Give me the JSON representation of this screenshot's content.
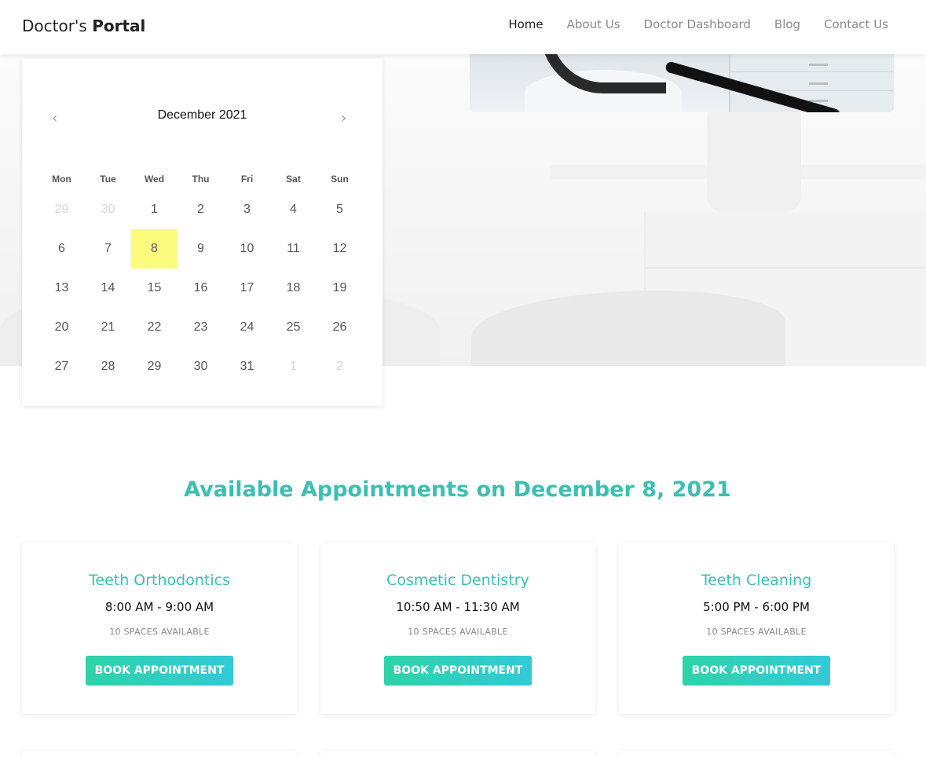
{
  "header": {
    "logo_regular": "Doctor's",
    "logo_bold": "Portal",
    "nav": [
      {
        "label": "Home",
        "active": true
      },
      {
        "label": "About Us"
      },
      {
        "label": "Doctor Dashboard"
      },
      {
        "label": "Blog"
      },
      {
        "label": "Contact Us"
      }
    ]
  },
  "calendar": {
    "month_label": "December 2021",
    "prev_icon": "‹",
    "next_icon": "›",
    "weekdays": [
      "Mon",
      "Tue",
      "Wed",
      "Thu",
      "Fri",
      "Sat",
      "Sun"
    ],
    "selected_day": "8",
    "days": [
      {
        "n": "29",
        "muted": true
      },
      {
        "n": "30",
        "muted": true
      },
      {
        "n": "1"
      },
      {
        "n": "2"
      },
      {
        "n": "3"
      },
      {
        "n": "4"
      },
      {
        "n": "5"
      },
      {
        "n": "6"
      },
      {
        "n": "7"
      },
      {
        "n": "8",
        "selected": true
      },
      {
        "n": "9"
      },
      {
        "n": "10"
      },
      {
        "n": "11"
      },
      {
        "n": "12"
      },
      {
        "n": "13"
      },
      {
        "n": "14"
      },
      {
        "n": "15"
      },
      {
        "n": "16"
      },
      {
        "n": "17"
      },
      {
        "n": "18"
      },
      {
        "n": "19"
      },
      {
        "n": "20"
      },
      {
        "n": "21"
      },
      {
        "n": "22"
      },
      {
        "n": "23"
      },
      {
        "n": "24"
      },
      {
        "n": "25"
      },
      {
        "n": "26"
      },
      {
        "n": "27"
      },
      {
        "n": "28"
      },
      {
        "n": "29"
      },
      {
        "n": "30"
      },
      {
        "n": "31"
      },
      {
        "n": "1",
        "muted": true
      },
      {
        "n": "2",
        "muted": true
      }
    ]
  },
  "appointments": {
    "heading": "Available Appointments on December 8, 2021",
    "cards": [
      {
        "name": "Teeth Orthodontics",
        "time": "8:00 AM - 9:00 AM",
        "spaces": "10 SPACES AVAILABLE",
        "button": "BOOK APPOINTMENT"
      },
      {
        "name": "Cosmetic Dentistry",
        "time": "10:50 AM - 11:30 AM",
        "spaces": "10 SPACES AVAILABLE",
        "button": "BOOK APPOINTMENT"
      },
      {
        "name": "Teeth Cleaning",
        "time": "5:00 PM - 6:00 PM",
        "spaces": "10 SPACES AVAILABLE",
        "button": "BOOK APPOINTMENT"
      }
    ]
  },
  "colors": {
    "accent": "#3cbfb3",
    "button_gradient_start": "#2ed3a8",
    "button_gradient_end": "#33c9d8",
    "selected_day_bg": "#fbfb7e"
  }
}
